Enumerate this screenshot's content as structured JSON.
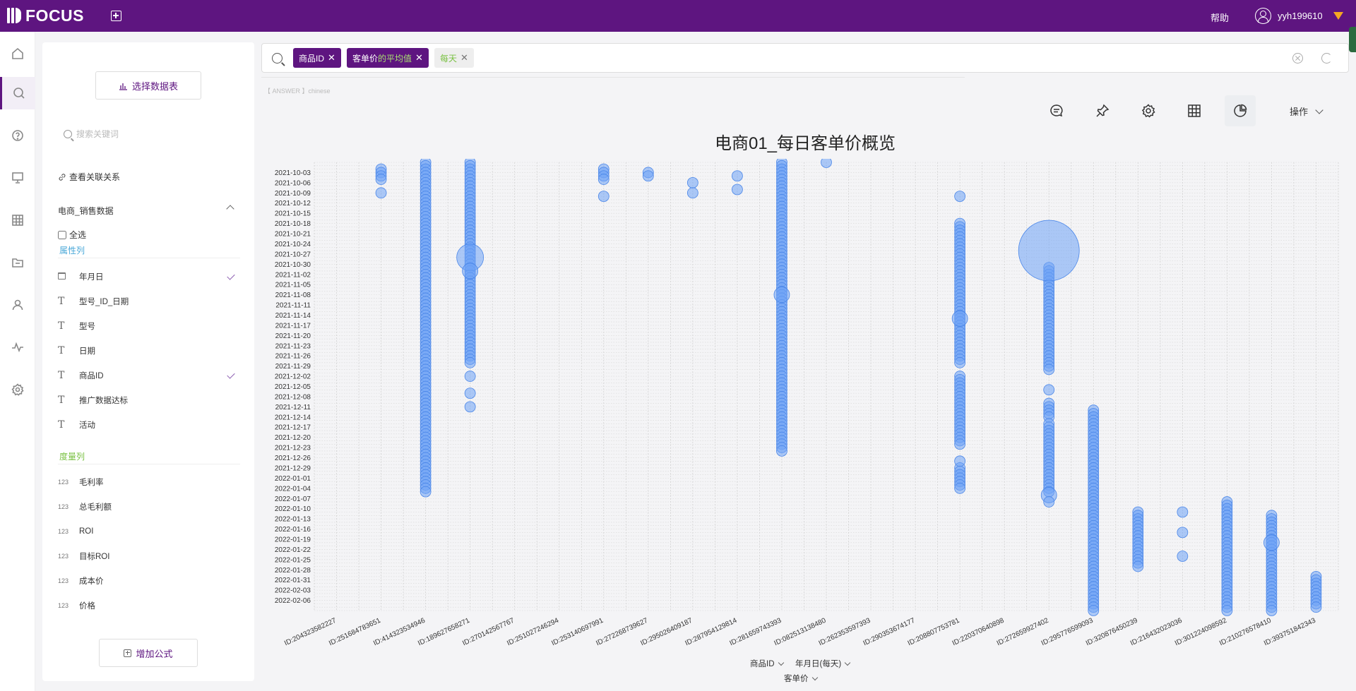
{
  "app": {
    "logo_text": "FOCUS",
    "help_label": "帮助",
    "username": "yyh199610"
  },
  "datapanel": {
    "select_table_label": "选择数据表",
    "search_placeholder": "搜索关键词",
    "relation_label": "查看关联关系",
    "table_name": "电商_销售数据",
    "select_all_label": "全选",
    "attr_section": "属性列",
    "measure_section": "度量列",
    "attr_fields": [
      {
        "label": "年月日",
        "type": "date",
        "checked": true
      },
      {
        "label": "型号_ID_日期",
        "type": "text",
        "checked": false
      },
      {
        "label": "型号",
        "type": "text",
        "checked": false
      },
      {
        "label": "日期",
        "type": "text",
        "checked": false
      },
      {
        "label": "商品ID",
        "type": "text",
        "checked": true
      },
      {
        "label": "推广数据达标",
        "type": "text",
        "checked": false
      },
      {
        "label": "活动",
        "type": "text",
        "checked": false
      }
    ],
    "measure_fields": [
      {
        "label": "毛利率",
        "type": "123"
      },
      {
        "label": "总毛利额",
        "type": "123"
      },
      {
        "label": "ROI",
        "type": "123"
      },
      {
        "label": "目标ROI",
        "type": "123"
      },
      {
        "label": "成本价",
        "type": "123"
      },
      {
        "label": "价格",
        "type": "123"
      }
    ],
    "add_formula_label": "增加公式"
  },
  "search": {
    "tokens": [
      {
        "text": "商品ID",
        "agg": "",
        "style": "dark"
      },
      {
        "text": "客单价",
        "agg": "的平均值",
        "style": "dark"
      },
      {
        "text": "每天",
        "agg": "",
        "style": "light"
      }
    ],
    "hint": "【 ANSWER 】chinese"
  },
  "toolbar": {
    "ops_label": "操作"
  },
  "colors": {
    "brand": "#5e1580",
    "bubble_fill": "#6ea3f5",
    "bubble_stroke": "#4a86e8"
  },
  "chart_data": {
    "type": "scatter",
    "title": "电商01_每日客单价概览",
    "x_field_label": "商品ID",
    "y_field_label": "年月日(每天)",
    "size_field_label": "客单价",
    "x_categories": [
      "ID:204323582227",
      "ID:251684783651",
      "ID:414323534946",
      "ID:189627658271",
      "ID:270142567767",
      "ID:251027246294",
      "ID:253140697991",
      "ID:272268739627",
      "ID:295026409187",
      "ID:287954129814",
      "ID:281659743393",
      "ID:082513138480",
      "ID:262353597393",
      "ID:290353674177",
      "ID:208807753781",
      "ID:220370640898",
      "ID:272659927402",
      "ID:295776599093",
      "ID:320876450239",
      "ID:216432023036",
      "ID:301224098592",
      "ID:210276578410",
      "ID:393751842343"
    ],
    "y_ticks": [
      "2021-10-03",
      "2021-10-06",
      "2021-10-09",
      "2021-10-12",
      "2021-10-15",
      "2021-10-18",
      "2021-10-21",
      "2021-10-24",
      "2021-10-27",
      "2021-10-30",
      "2021-11-02",
      "2021-11-05",
      "2021-11-08",
      "2021-11-11",
      "2021-11-14",
      "2021-11-17",
      "2021-11-20",
      "2021-11-23",
      "2021-11-26",
      "2021-11-29",
      "2021-12-02",
      "2021-12-05",
      "2021-12-08",
      "2021-12-11",
      "2021-12-14",
      "2021-12-17",
      "2021-12-20",
      "2021-12-23",
      "2021-12-26",
      "2021-12-29",
      "2022-01-01",
      "2022-01-04",
      "2022-01-07",
      "2022-01-10",
      "2022-01-13",
      "2022-01-16",
      "2022-01-19",
      "2022-01-22",
      "2022-01-25",
      "2022-01-28",
      "2022-01-31",
      "2022-02-03",
      "2022-02-06"
    ],
    "y_range": [
      "2021-09-30",
      "2022-02-09"
    ],
    "grid": true,
    "series": [
      {
        "x": "ID:251684783651",
        "ranges": [
          [
            "2021-10-02",
            "2021-10-05"
          ]
        ],
        "points": [
          {
            "date": "2021-10-09",
            "size": "normal"
          }
        ]
      },
      {
        "x": "ID:414323534946",
        "ranges": [
          [
            "2021-09-30",
            "2022-01-05"
          ]
        ],
        "points": []
      },
      {
        "x": "ID:189627658271",
        "ranges": [
          [
            "2021-09-30",
            "2021-11-28"
          ]
        ],
        "points": [
          {
            "date": "2021-10-28",
            "size": "large"
          },
          {
            "date": "2021-11-01",
            "size": "medium"
          },
          {
            "date": "2021-12-02",
            "size": "normal"
          },
          {
            "date": "2021-12-07",
            "size": "normal"
          },
          {
            "date": "2021-12-11",
            "size": "normal"
          }
        ]
      },
      {
        "x": "ID:253140697991",
        "ranges": [
          [
            "2021-10-02",
            "2021-10-05"
          ]
        ],
        "points": [
          {
            "date": "2021-10-10",
            "size": "normal"
          }
        ]
      },
      {
        "x": "ID:272268739627",
        "ranges": [
          [
            "2021-10-03",
            "2021-10-04"
          ]
        ],
        "points": []
      },
      {
        "x": "ID:295026409187",
        "ranges": [],
        "points": [
          {
            "date": "2021-10-06",
            "size": "normal"
          },
          {
            "date": "2021-10-09",
            "size": "normal"
          }
        ]
      },
      {
        "x": "ID:287954129814",
        "ranges": [],
        "points": [
          {
            "date": "2021-10-04",
            "size": "normal"
          },
          {
            "date": "2021-10-08",
            "size": "normal"
          }
        ]
      },
      {
        "x": "ID:281659743393",
        "ranges": [
          [
            "2021-09-30",
            "2021-12-24"
          ]
        ],
        "points": [
          {
            "date": "2021-11-08",
            "size": "medium"
          }
        ]
      },
      {
        "x": "ID:082513138480",
        "ranges": [],
        "points": [
          {
            "date": "2021-09-30",
            "size": "normal"
          }
        ]
      },
      {
        "x": "ID:208807753781",
        "ranges": [
          [
            "2021-10-18",
            "2021-11-28"
          ],
          [
            "2021-12-02",
            "2021-12-22"
          ],
          [
            "2021-12-29",
            "2022-01-04"
          ]
        ],
        "points": [
          {
            "date": "2021-10-10",
            "size": "normal"
          },
          {
            "date": "2021-11-15",
            "size": "medium"
          },
          {
            "date": "2021-12-27",
            "size": "normal"
          }
        ]
      },
      {
        "x": "ID:272659927402",
        "ranges": [
          [
            "2021-10-31",
            "2021-11-30"
          ],
          [
            "2021-12-10",
            "2021-12-14"
          ],
          [
            "2021-12-16",
            "2022-01-05"
          ]
        ],
        "points": [
          {
            "date": "2021-10-26",
            "size": "xlarge"
          },
          {
            "date": "2021-12-06",
            "size": "normal"
          },
          {
            "date": "2022-01-06",
            "size": "medium"
          },
          {
            "date": "2022-01-08",
            "size": "normal"
          }
        ]
      },
      {
        "x": "ID:295776599093",
        "ranges": [
          [
            "2021-12-12",
            "2022-02-09"
          ]
        ],
        "points": []
      },
      {
        "x": "ID:320876450239",
        "ranges": [
          [
            "2022-01-11",
            "2022-01-27"
          ]
        ],
        "points": []
      },
      {
        "x": "ID:216432023036",
        "ranges": [],
        "points": [
          {
            "date": "2022-01-11",
            "size": "normal"
          },
          {
            "date": "2022-01-17",
            "size": "normal"
          },
          {
            "date": "2022-01-24",
            "size": "normal"
          }
        ]
      },
      {
        "x": "ID:301224098592",
        "ranges": [
          [
            "2022-01-08",
            "2022-02-09"
          ]
        ],
        "points": []
      },
      {
        "x": "ID:210276578410",
        "ranges": [
          [
            "2022-01-12",
            "2022-02-09"
          ]
        ],
        "points": [
          {
            "date": "2022-01-20",
            "size": "medium"
          }
        ]
      },
      {
        "x": "ID:393751842343",
        "ranges": [
          [
            "2022-01-30",
            "2022-02-08"
          ]
        ],
        "points": []
      }
    ]
  }
}
